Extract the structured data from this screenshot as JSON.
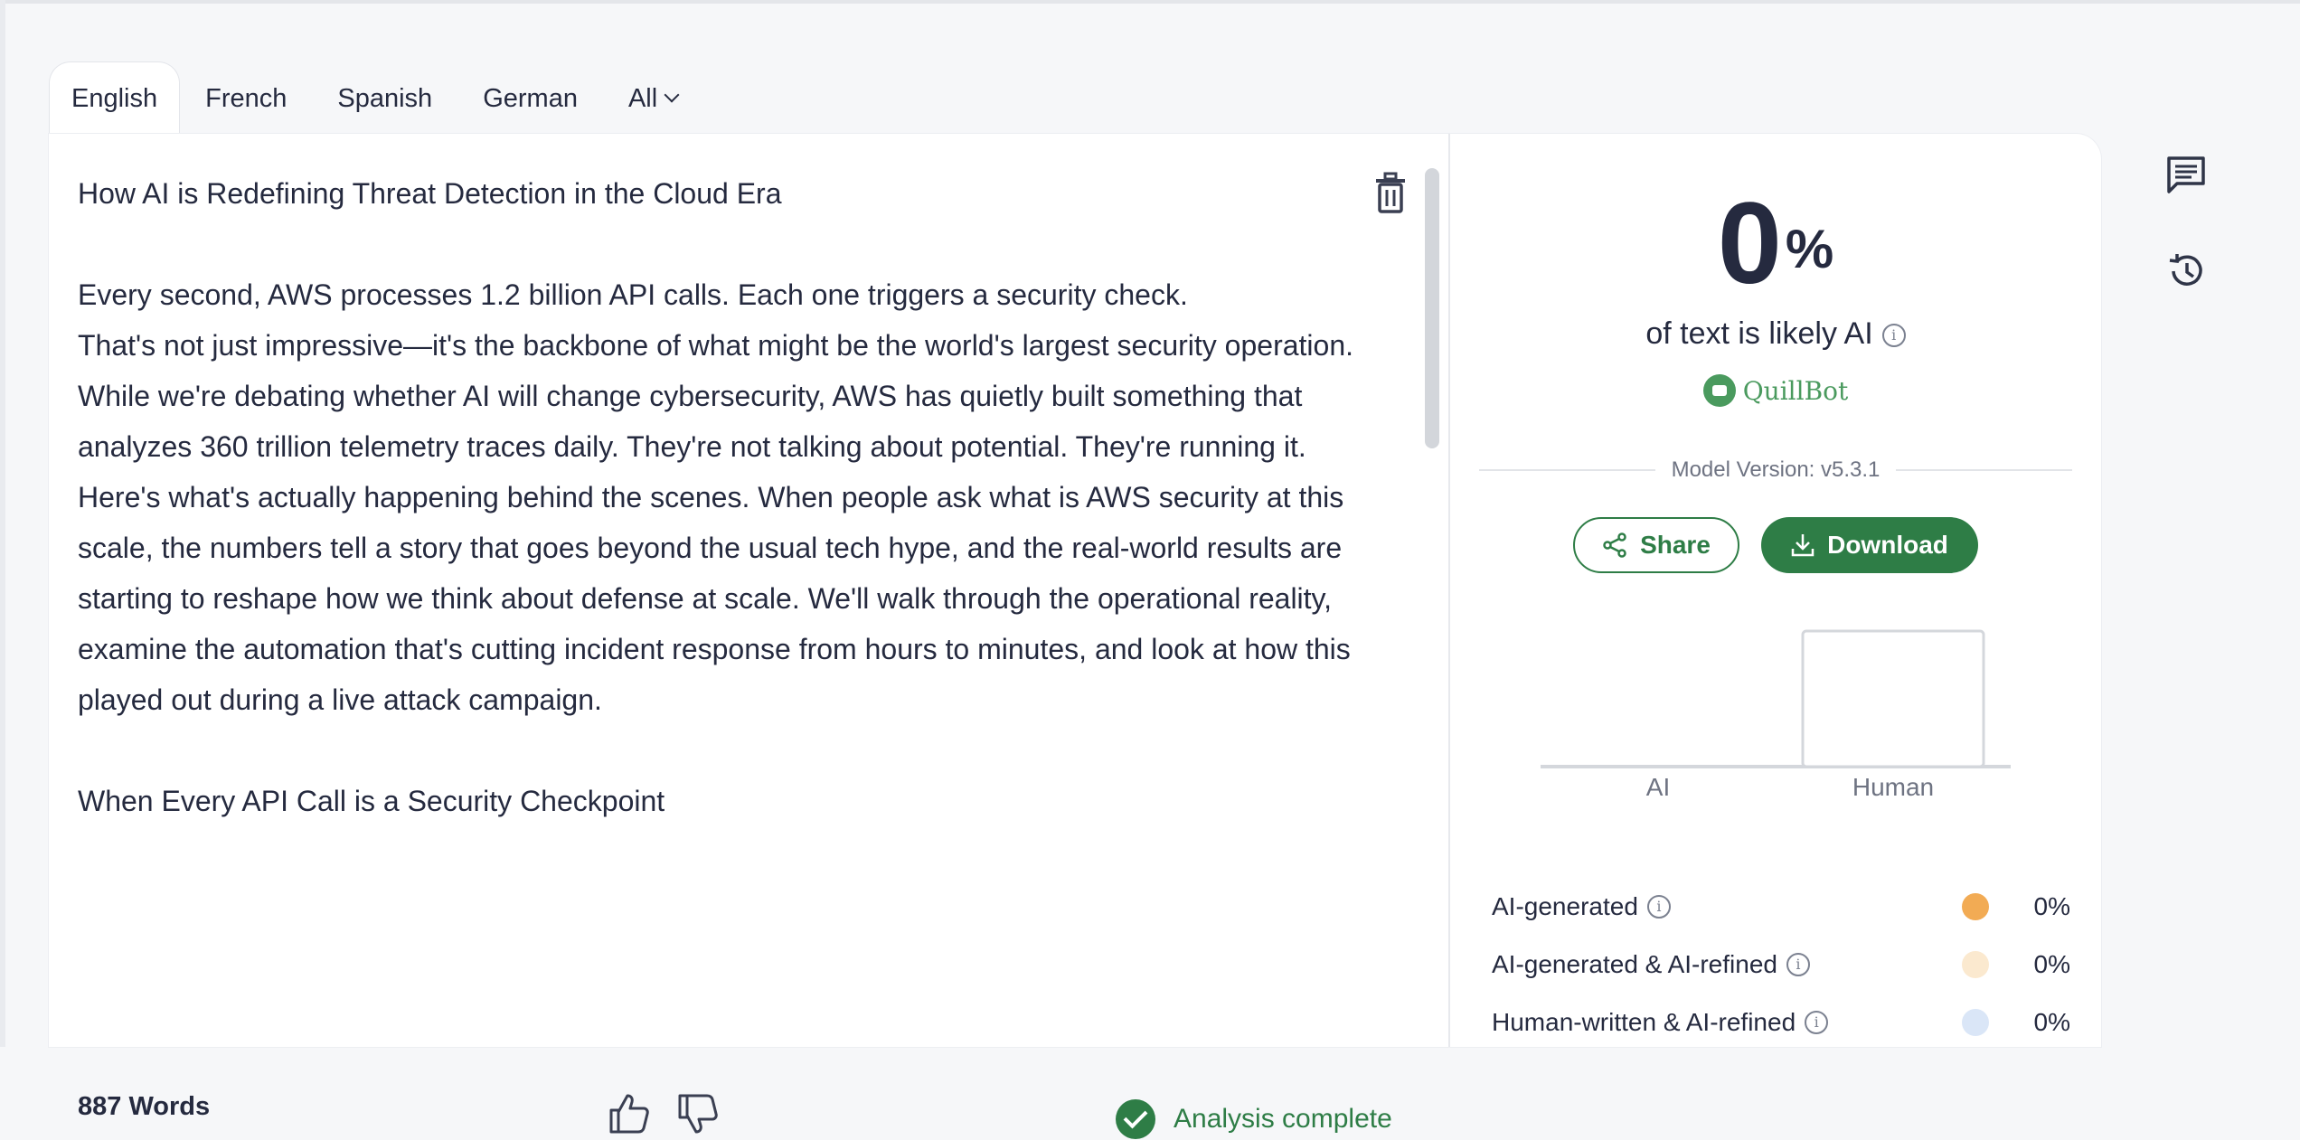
{
  "tabs": [
    {
      "label": "English",
      "active": true
    },
    {
      "label": "French"
    },
    {
      "label": "Spanish"
    },
    {
      "label": "German"
    },
    {
      "label": "All"
    }
  ],
  "editor": {
    "paragraphs": [
      "How AI is Redefining Threat Detection in the Cloud Era",
      "",
      "Every second, AWS processes 1.2 billion API calls. Each one triggers a security check.",
      "That's not just impressive—it's the backbone of what might be the world's largest security operation. While we're debating whether AI will change cybersecurity, AWS has quietly built something that analyzes 360 trillion telemetry traces daily. They're not talking about potential. They're running it.",
      "Here's what's actually happening behind the scenes. When people ask what is AWS security at this scale, the numbers tell a story that goes beyond the usual tech hype, and the real-world results are starting to reshape how we think about defense at scale. We'll walk through the operational reality, examine the automation that's cutting incident response from hours to minutes, and look at how this played out during a live attack campaign.",
      "",
      "When Every API Call is a Security Checkpoint"
    ],
    "word_count": "887 Words",
    "status": "Analysis complete"
  },
  "results": {
    "percent": "0",
    "percent_sign": "%",
    "subtitle": "of text is likely AI",
    "brand": "QuillBot",
    "model_version": "Model Version: v5.3.1",
    "share_label": "Share",
    "download_label": "Download",
    "legend": [
      {
        "label": "AI-generated",
        "value": "0%",
        "color": "#f2ab54"
      },
      {
        "label": "AI-generated & AI-refined",
        "value": "0%",
        "color": "#fbe9cf"
      },
      {
        "label": "Human-written & AI-refined",
        "value": "0%",
        "color": "#dae6f7"
      }
    ]
  },
  "chart_data": {
    "type": "bar",
    "categories": [
      "AI",
      "Human"
    ],
    "values": [
      0,
      100
    ],
    "ylim": [
      0,
      100
    ]
  },
  "icons": {
    "trash": "trash-icon",
    "thumbs_up": "thumbs-up-icon",
    "thumbs_down": "thumbs-down-icon",
    "comment": "comment-icon",
    "history": "history-icon",
    "share": "share-icon",
    "download": "download-icon",
    "info": "info-icon"
  },
  "colors": {
    "accent": "#2e7d46",
    "text": "#252a3f"
  }
}
